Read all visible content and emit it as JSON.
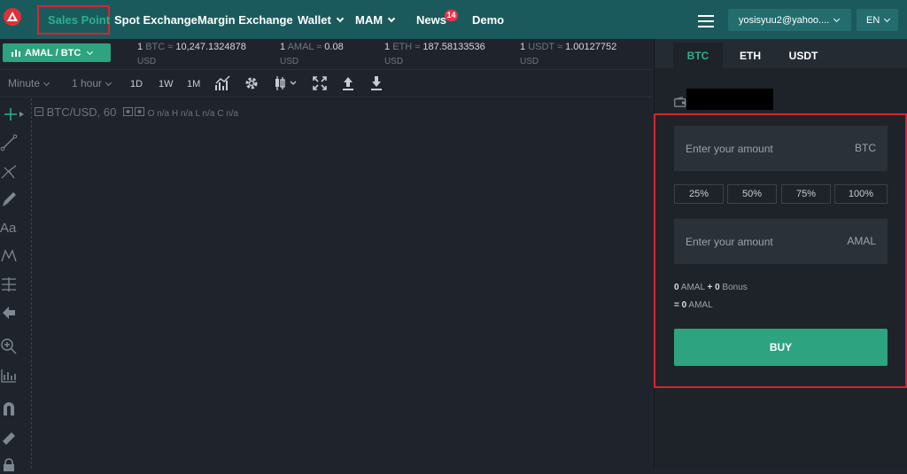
{
  "nav": {
    "items": [
      {
        "label": "Sales Point"
      },
      {
        "label": "Spot Exchange"
      },
      {
        "label": "Margin Exchange"
      },
      {
        "label": "Wallet"
      },
      {
        "label": "MAM"
      },
      {
        "label": "News"
      },
      {
        "label": "Demo"
      }
    ],
    "news_badge": "14",
    "user_email": "yosisyuu2@yahoo....",
    "language": "EN"
  },
  "ticker": {
    "pair_label": "AMAL / BTC",
    "rates": [
      {
        "base": "1",
        "base_cur": "BTC",
        "approx": "≈",
        "value": "10,247.1324878",
        "quote": "USD"
      },
      {
        "base": "1",
        "base_cur": "AMAL",
        "approx": "≈",
        "value": "0.08",
        "quote": "USD"
      },
      {
        "base": "1",
        "base_cur": "ETH",
        "approx": "≈",
        "value": "187.58133536",
        "quote": "USD"
      },
      {
        "base": "1",
        "base_cur": "USDT",
        "approx": "≈",
        "value": "1.00127752",
        "quote": "USD"
      }
    ]
  },
  "chart_toolbar": {
    "interval_unit": "Minute",
    "interval": "1 hour",
    "ranges": [
      "1D",
      "1W",
      "1M"
    ]
  },
  "chart": {
    "symbol": "BTC/USD, 60",
    "ohlc": "O n/a  H n/a  L n/a  C n/a",
    "text_tool": "Aa"
  },
  "panel": {
    "tabs": [
      "BTC",
      "ETH",
      "USDT"
    ],
    "active_tab": "BTC",
    "amount_placeholder": "Enter your amount",
    "pay_currency": "BTC",
    "receive_currency": "AMAL",
    "percents": [
      "25%",
      "50%",
      "75%",
      "100%"
    ],
    "summary_line1": {
      "amount": "0",
      "cur": "AMAL",
      "plus": "+",
      "bonus": "0",
      "bonus_label": "Bonus"
    },
    "summary_line2": {
      "eq": "=",
      "amount": "0",
      "cur": "AMAL"
    },
    "buy_label": "BUY"
  },
  "colors": {
    "nav_bg": "#1b5a5c",
    "accent": "#2ea37f",
    "highlight_box": "#d8242c",
    "badge": "#e8334a"
  }
}
